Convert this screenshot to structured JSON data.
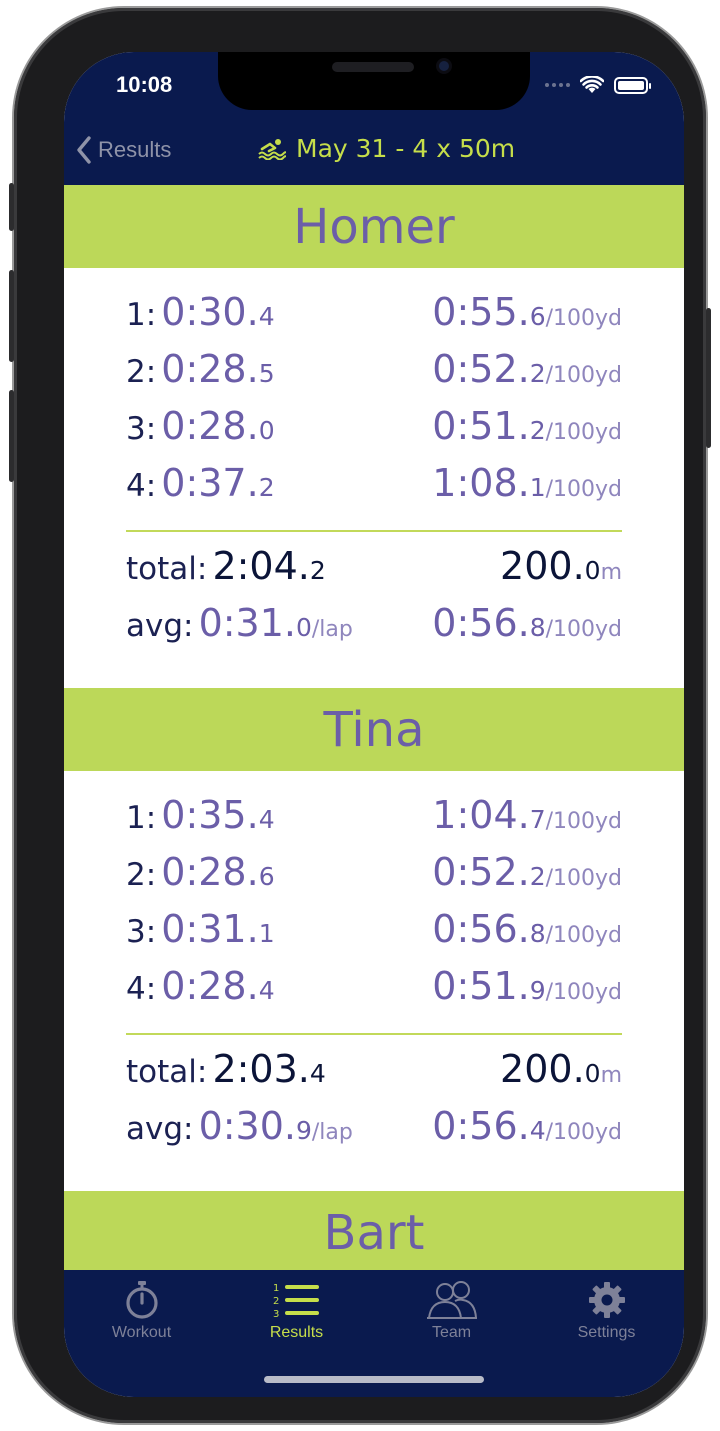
{
  "status": {
    "time": "10:08"
  },
  "nav": {
    "back_label": "Results",
    "title": "May 31 - 4 x 50m"
  },
  "swimmers": [
    {
      "name": "Homer",
      "laps": [
        {
          "label": "1:",
          "time_main": "0:30.",
          "time_dec": "4",
          "pace_main": "0:55.",
          "pace_dec": "6",
          "pace_unit": "/100yd"
        },
        {
          "label": "2:",
          "time_main": "0:28.",
          "time_dec": "5",
          "pace_main": "0:52.",
          "pace_dec": "2",
          "pace_unit": "/100yd"
        },
        {
          "label": "3:",
          "time_main": "0:28.",
          "time_dec": "0",
          "pace_main": "0:51.",
          "pace_dec": "2",
          "pace_unit": "/100yd"
        },
        {
          "label": "4:",
          "time_main": "0:37.",
          "time_dec": "2",
          "pace_main": "1:08.",
          "pace_dec": "1",
          "pace_unit": "/100yd"
        }
      ],
      "total": {
        "label": "total:",
        "time_main": "2:04.",
        "time_dec": "2",
        "dist_main": "200.",
        "dist_dec": "0",
        "dist_unit": "m"
      },
      "avg": {
        "label": "avg:",
        "time_main": "0:31.",
        "time_dec": "0",
        "time_unit": "/lap",
        "pace_main": "0:56.",
        "pace_dec": "8",
        "pace_unit": "/100yd"
      }
    },
    {
      "name": "Tina",
      "laps": [
        {
          "label": "1:",
          "time_main": "0:35.",
          "time_dec": "4",
          "pace_main": "1:04.",
          "pace_dec": "7",
          "pace_unit": "/100yd"
        },
        {
          "label": "2:",
          "time_main": "0:28.",
          "time_dec": "6",
          "pace_main": "0:52.",
          "pace_dec": "2",
          "pace_unit": "/100yd"
        },
        {
          "label": "3:",
          "time_main": "0:31.",
          "time_dec": "1",
          "pace_main": "0:56.",
          "pace_dec": "8",
          "pace_unit": "/100yd"
        },
        {
          "label": "4:",
          "time_main": "0:28.",
          "time_dec": "4",
          "pace_main": "0:51.",
          "pace_dec": "9",
          "pace_unit": "/100yd"
        }
      ],
      "total": {
        "label": "total:",
        "time_main": "2:03.",
        "time_dec": "4",
        "dist_main": "200.",
        "dist_dec": "0",
        "dist_unit": "m"
      },
      "avg": {
        "label": "avg:",
        "time_main": "0:30.",
        "time_dec": "9",
        "time_unit": "/lap",
        "pace_main": "0:56.",
        "pace_dec": "4",
        "pace_unit": "/100yd"
      }
    },
    {
      "name": "Bart"
    }
  ],
  "tabs": [
    {
      "label": "Workout",
      "icon": "stopwatch-icon"
    },
    {
      "label": "Results",
      "icon": "numbered-list-icon",
      "list_nums": [
        "1",
        "2",
        "3"
      ]
    },
    {
      "label": "Team",
      "icon": "team-icon"
    },
    {
      "label": "Settings",
      "icon": "gear-icon"
    }
  ],
  "colors": {
    "nav_bg": "#0a1a4e",
    "accent": "#c6de4a",
    "banner": "#bcd859",
    "value": "#6b5ea8"
  }
}
